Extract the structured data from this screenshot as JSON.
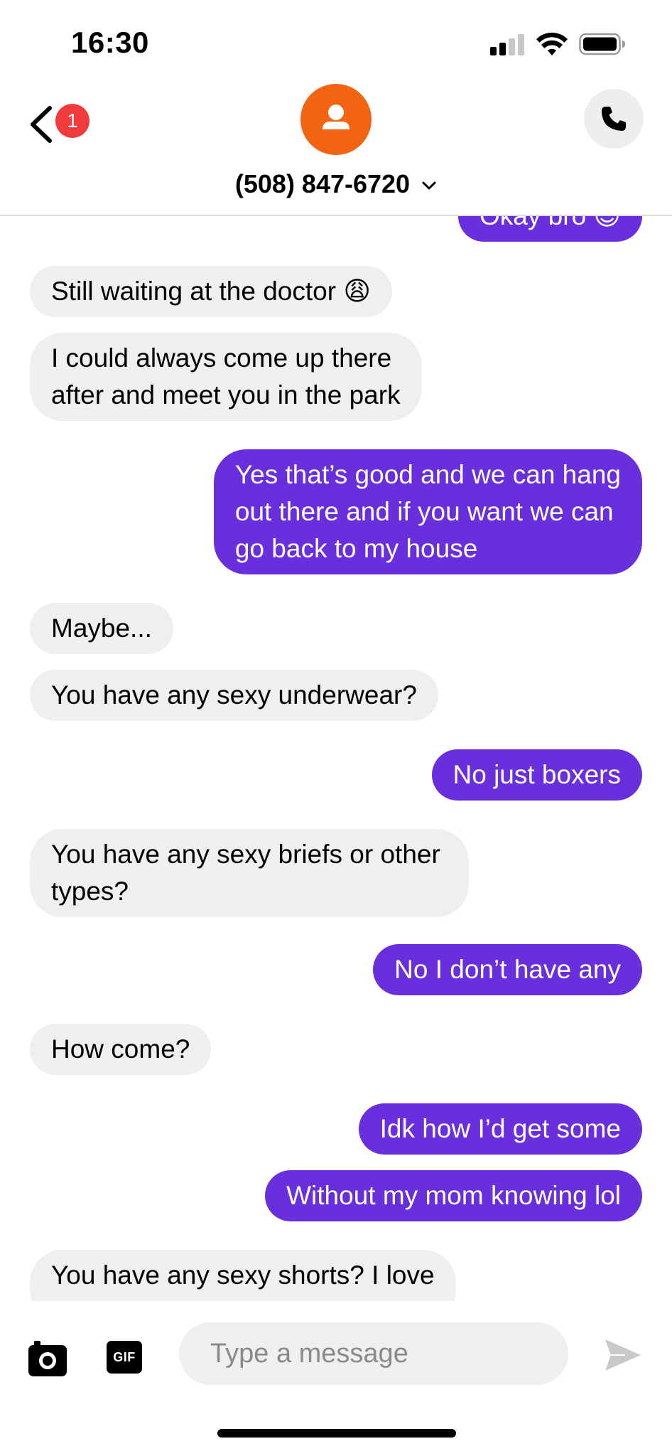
{
  "status_bar": {
    "time": "16:30"
  },
  "header": {
    "unread_count": "1",
    "contact_name": "(508) 847-6720"
  },
  "messages": [
    {
      "dir": "out",
      "text": "Okay bro 😊"
    },
    {
      "dir": "in",
      "text": "Still waiting at the doctor 😩"
    },
    {
      "dir": "in",
      "text": "I could always come up there\nafter and meet you in the park"
    },
    {
      "dir": "out",
      "text": "Yes that’s good and we can hang\nout there and if you want we can\ngo back to my house"
    },
    {
      "dir": "in",
      "text": "Maybe..."
    },
    {
      "dir": "in",
      "text": "You have any sexy underwear?"
    },
    {
      "dir": "out",
      "text": "No just boxers"
    },
    {
      "dir": "in",
      "text": "You have any sexy briefs or other\ntypes?"
    },
    {
      "dir": "out",
      "text": "No I don’t have any"
    },
    {
      "dir": "in",
      "text": "How come?"
    },
    {
      "dir": "out",
      "text": "Idk how I’d get some"
    },
    {
      "dir": "out",
      "text": "Without my mom knowing lol"
    },
    {
      "dir": "in",
      "text": "You have any sexy shorts?  I love"
    }
  ],
  "composer": {
    "gif_label": "GIF",
    "placeholder": "Type a message"
  },
  "colors": {
    "outgoing_bubble": "#6a2fdd",
    "incoming_bubble": "#efefef",
    "avatar": "#f26411",
    "badge": "#ef3b3b"
  }
}
